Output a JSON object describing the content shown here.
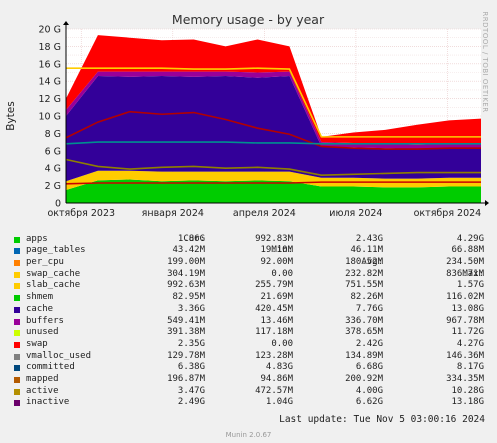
{
  "chart_data": {
    "type": "area",
    "title": "Memory usage - by year",
    "ylabel": "Bytes",
    "side_label": "RRDTOOL / TOBI OETIKER",
    "ylim": [
      0,
      20
    ],
    "y_ticks": [
      "0",
      "2 G",
      "4 G",
      "6 G",
      "8 G",
      "10 G",
      "12 G",
      "14 G",
      "16 G",
      "18 G",
      "20 G"
    ],
    "x_ticks": [
      "октября 2023",
      "января 2024",
      "апреля 2024",
      "июля 2024",
      "октября 2024"
    ],
    "x_tick_months": [
      0,
      3,
      6,
      9,
      12
    ],
    "x_range_months": [
      -0.5,
      13.1
    ],
    "colors": {
      "apps": "#00cc00",
      "page_tables": "#0066b3",
      "per_cpu": "#ff8000",
      "swap_cache": "#ffcc00",
      "slab_cache": "#330099",
      "shmem": "#990099",
      "cache": "#ccff00",
      "buffers": "#ff0000",
      "unused": "#808080",
      "swap": "#008f00",
      "vmalloc_used": "#00487d",
      "committed": "#b35a00",
      "mapped": "#b38f00",
      "active": "#6b006b",
      "inactive": "#8fb300"
    },
    "series_stack": [
      {
        "name": "apps",
        "color": "#00cc00",
        "values": [
          1.5,
          2.6,
          2.7,
          2.5,
          2.6,
          2.5,
          2.6,
          2.5,
          1.9,
          1.9,
          1.8,
          1.8,
          1.9,
          1.9
        ]
      },
      {
        "name": "slab_cache",
        "color": "#ffcc00",
        "values": [
          1.0,
          1.1,
          1.0,
          1.1,
          1.0,
          1.1,
          1.0,
          1.1,
          1.0,
          1.0,
          1.0,
          1.0,
          1.0,
          1.0
        ]
      },
      {
        "name": "cache",
        "color": "#330099",
        "values": [
          7.5,
          10.9,
          10.8,
          11.0,
          10.9,
          11.0,
          10.8,
          11.0,
          3.6,
          3.5,
          3.5,
          3.4,
          3.4,
          3.4
        ]
      },
      {
        "name": "buffers",
        "color": "#990099",
        "values": [
          0.7,
          0.5,
          0.6,
          0.5,
          0.6,
          0.5,
          0.6,
          0.5,
          0.5,
          0.5,
          0.5,
          0.5,
          0.5,
          0.5
        ]
      },
      {
        "name": "unused",
        "color": "#ff0000",
        "values": [
          1.3,
          4.2,
          3.9,
          3.6,
          3.7,
          2.9,
          3.8,
          2.9,
          0.6,
          1.2,
          1.6,
          2.3,
          2.7,
          2.9
        ]
      }
    ],
    "lines": [
      {
        "name": "committed",
        "color": "#ffcc00",
        "values": [
          15.5,
          15.5,
          15.5,
          15.5,
          15.4,
          15.4,
          15.5,
          15.4,
          7.6,
          7.6,
          7.6,
          7.6,
          7.6,
          7.6
        ]
      },
      {
        "name": "inactive",
        "color": "#b30000",
        "values": [
          7.5,
          9.3,
          10.5,
          10.2,
          10.4,
          9.6,
          8.6,
          7.9,
          6.5,
          6.3,
          6.2,
          6.2,
          6.3,
          6.3
        ]
      },
      {
        "name": "page_tables",
        "color": "#008f8f",
        "values": [
          6.8,
          7.0,
          7.0,
          7.0,
          7.0,
          7.0,
          6.9,
          6.9,
          6.8,
          6.8,
          6.8,
          6.8,
          6.8,
          6.8
        ]
      },
      {
        "name": "active",
        "color": "#8f7f00",
        "values": [
          5.0,
          4.2,
          3.9,
          4.1,
          4.2,
          4.0,
          4.1,
          3.9,
          3.2,
          3.3,
          3.4,
          3.5,
          3.5,
          3.5
        ]
      },
      {
        "name": "swap",
        "color": "#cc0000",
        "values": [
          2.2,
          2.3,
          2.3,
          2.3,
          2.3,
          2.3,
          2.3,
          2.3,
          2.4,
          2.4,
          2.4,
          2.4,
          2.4,
          2.4
        ]
      }
    ],
    "legend_header": {
      "cur": "Cur:",
      "min": "Min:",
      "avg": "Avg:",
      "max": "Max:"
    },
    "legend": [
      {
        "name": "apps",
        "color": "#00cc00",
        "cur": "1.86G",
        "min": "992.83M",
        "avg": "2.43G",
        "max": "4.29G"
      },
      {
        "name": "page_tables",
        "color": "#0066b3",
        "cur": "43.42M",
        "min": "19.10M",
        "avg": "46.11M",
        "max": "66.88M"
      },
      {
        "name": "per_cpu",
        "color": "#ff8000",
        "cur": "199.00M",
        "min": "92.00M",
        "avg": "180.52M",
        "max": "234.50M"
      },
      {
        "name": "swap_cache",
        "color": "#ffcc00",
        "cur": "304.19M",
        "min": "0.00",
        "avg": "232.82M",
        "max": "836.71M"
      },
      {
        "name": "slab_cache",
        "color": "#ffcc00",
        "cur": "992.63M",
        "min": "255.79M",
        "avg": "751.55M",
        "max": "1.57G"
      },
      {
        "name": "shmem",
        "color": "#00cc00",
        "cur": "82.95M",
        "min": "21.69M",
        "avg": "82.26M",
        "max": "116.02M"
      },
      {
        "name": "cache",
        "color": "#330099",
        "cur": "3.36G",
        "min": "420.45M",
        "avg": "7.76G",
        "max": "13.08G"
      },
      {
        "name": "buffers",
        "color": "#990099",
        "cur": "549.41M",
        "min": "13.46M",
        "avg": "336.70M",
        "max": "967.78M"
      },
      {
        "name": "unused",
        "color": "#ccff00",
        "cur": "391.38M",
        "min": "117.18M",
        "avg": "378.65M",
        "max": "11.72G"
      },
      {
        "name": "swap",
        "color": "#ff0000",
        "cur": "2.35G",
        "min": "0.00",
        "avg": "2.42G",
        "max": "4.27G"
      },
      {
        "name": "vmalloc_used",
        "color": "#808080",
        "cur": "129.78M",
        "min": "123.28M",
        "avg": "134.89M",
        "max": "146.36M"
      },
      {
        "name": "committed",
        "color": "#00487d",
        "cur": "6.38G",
        "min": "4.83G",
        "avg": "6.68G",
        "max": "8.17G"
      },
      {
        "name": "mapped",
        "color": "#b35a00",
        "cur": "196.87M",
        "min": "94.86M",
        "avg": "200.92M",
        "max": "334.35M"
      },
      {
        "name": "active",
        "color": "#b38f00",
        "cur": "3.47G",
        "min": "472.57M",
        "avg": "4.00G",
        "max": "10.28G"
      },
      {
        "name": "inactive",
        "color": "#6b006b",
        "cur": "2.49G",
        "min": "1.04G",
        "avg": "6.62G",
        "max": "13.18G"
      }
    ],
    "last_update": "Last update:  Tue Nov  5 03:00:16 2024",
    "footer": "Munin 2.0.67"
  }
}
